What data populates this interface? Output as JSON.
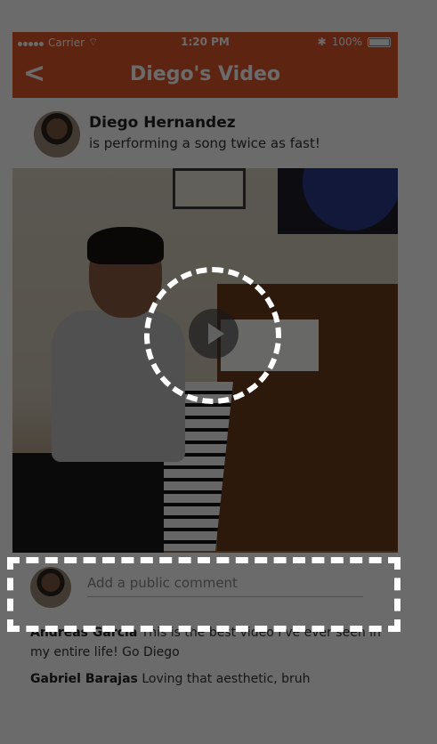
{
  "status_bar": {
    "carrier": "Carrier",
    "time": "1:20 PM",
    "battery": "100%"
  },
  "nav": {
    "back_icon": "chevron-left-icon",
    "title": "Diego's Video"
  },
  "post": {
    "author": "Diego Hernandez",
    "caption": "is performing a song twice as fast!"
  },
  "video": {
    "play_icon": "play-icon"
  },
  "comment_input": {
    "placeholder": "Add a public comment"
  },
  "comments": [
    {
      "name": "Andreas Garcia",
      "text": "This is the best video I've ever seen in my entire life! Go Diego"
    },
    {
      "name": "Gabriel Barajas",
      "text": "Loving that aesthetic, bruh"
    }
  ],
  "colors": {
    "accent": "#e0572b",
    "overlay": "#000000",
    "highlight": "#ffffff"
  }
}
